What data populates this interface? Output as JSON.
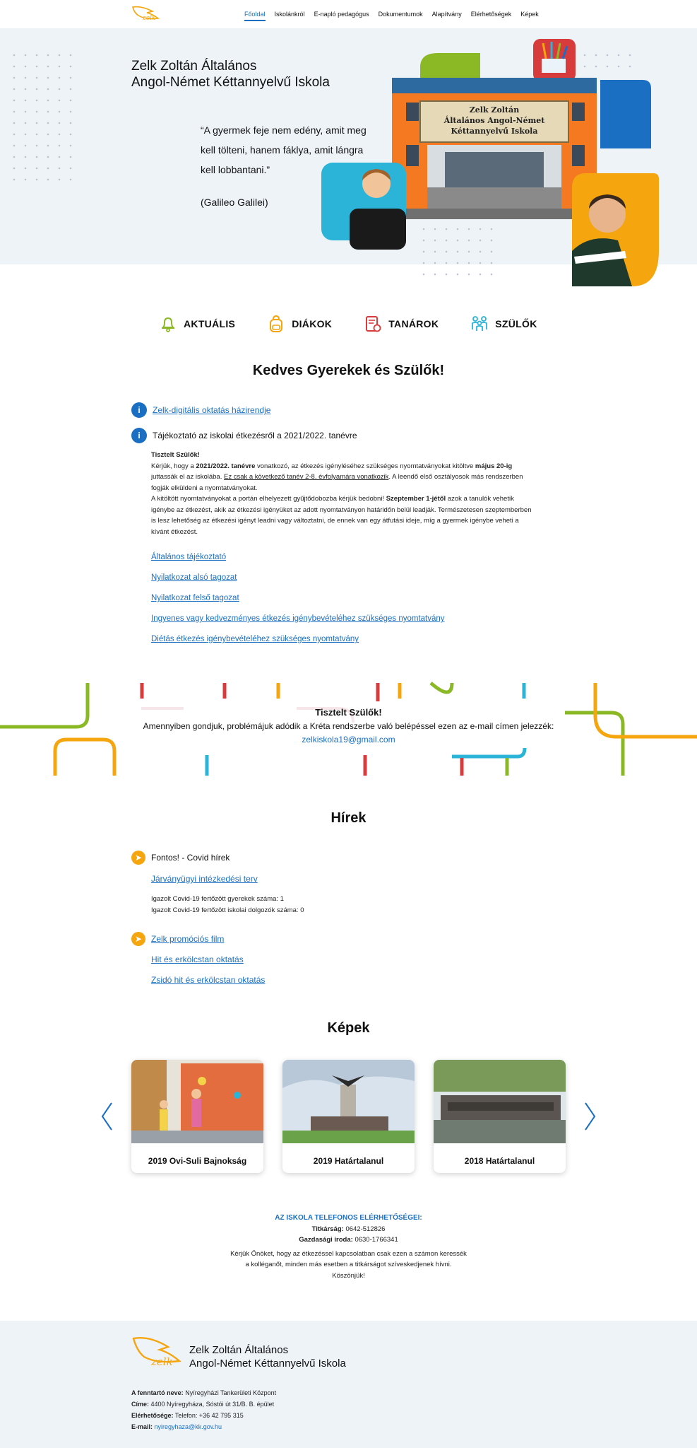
{
  "nav": {
    "items": [
      "Főoldal",
      "Iskolánkról",
      "E-napló pedagógus",
      "Dokumentumok",
      "Alapítvány",
      "Elérhetőségek",
      "Képek"
    ],
    "active": "Főoldal"
  },
  "hero": {
    "title_line1": "Zelk Zoltán Általános",
    "title_line2": "Angol-Német Kéttannyelvű Iskola",
    "quote": "“A gyermek feje nem edény, amit meg kell tölteni, hanem fáklya, amit lángra kell lobbantani.”",
    "author": "(Galileo Galilei)",
    "sign_line1": "Zelk Zoltán",
    "sign_line2": "Általános Angol-Német",
    "sign_line3": "Kéttannyelvű Iskola"
  },
  "categories": [
    {
      "label": "AKTUÁLIS",
      "icon": "bell-icon",
      "color": "#8ab925"
    },
    {
      "label": "DIÁKOK",
      "icon": "backpack-icon",
      "color": "#f5a50e"
    },
    {
      "label": "TANÁROK",
      "icon": "teacher-icon",
      "color": "#d83b3b"
    },
    {
      "label": "SZÜLŐK",
      "icon": "parents-icon",
      "color": "#2bb3d8"
    }
  ],
  "welcome": {
    "heading": "Kedves Gyerekek és Szülők!",
    "link1": "Zelk-digitális oktatás házirendje",
    "item2": "Tájékoztató az iskolai étkezésről a 2021/2022. tanévre",
    "greeting": "Tisztelt Szülők!",
    "p1_a": "Kérjük, hogy a ",
    "p1_b": "2021/2022. tanévre",
    "p1_c": " vonatkozó, az étkezés igényléséhez szükséges nyomtatványokat kitöltve ",
    "p1_d": "május 20-ig",
    "p1_e": " juttassák el az iskolába. ",
    "p1_f": "Ez csak a következő tanév 2-8. évfolyamára vonatkozik",
    "p1_g": ". A leendő első osztályosok más rendszerben fogják elküldeni a nyomtatványokat.",
    "p2_a": "A kitöltött nyomtatványokat a portán elhelyezett gyűjtődobozba kérjük bedobni! ",
    "p2_b": "Szeptember 1-jétől",
    "p2_c": " azok a tanulók vehetik igénybe az étkezést, akik az étkezési igényüket az adott nyomtatványon határidőn belül leadják. Természetesen szeptemberben is lesz lehetőség az étkezési igényt leadni vagy változtatni, de ennek van egy átfutási ideje, míg a gyermek igénybe veheti a kívánt étkezést.",
    "links": [
      "Általános tájékoztató",
      "Nyilatkozat alsó tagozat",
      "Nyilatkozat felső tagozat",
      "Ingyenes vagy kedvezményes étkezés igénybevételéhez szükséges nyomtatvány",
      "Diétás étkezés igénybevételéhez szükséges nyomtatvány"
    ]
  },
  "banner": {
    "title": "Tisztelt Szülők!",
    "text": "Amennyiben gondjuk, problémájuk adódik a Kréta rendszerbe való belépéssel ezen az e-mail címen jelezzék:",
    "email": "zelkiskola19@gmail.com"
  },
  "news": {
    "heading": "Hírek",
    "item1": "Fontos! - Covid hírek",
    "link1": "Járványügyi intézkedési terv",
    "stat1": "Igazolt Covid-19 fertőzött gyerekek száma: 1",
    "stat2": "Igazolt Covid-19 fertőzött iskolai dolgozók száma: 0",
    "link2": "Zelk promóciós film",
    "link3": "Hit és erkölcstan oktatás",
    "link4": "Zsidó hit és erkölcstan oktatás"
  },
  "gallery": {
    "heading": "Képek",
    "cards": [
      "2019 Ovi-Suli Bajnokság",
      "2019 Határtalanul",
      "2018 Határtalanul"
    ]
  },
  "contact": {
    "title": "AZ ISKOLA TELEFONOS ELÉRHETŐSÉGEI:",
    "sec_label": "Titkárság:",
    "sec_value": "0642-512826",
    "eco_label": "Gazdasági iroda:",
    "eco_value": "0630-1766341",
    "note1": "Kérjük Önöket, hogy az étkezéssel kapcsolatban csak ezen a számon keressék",
    "note2": "a kolléganőt, minden más esetben a titkárságot szíveskedjenek hívni.",
    "note3": "Köszönjük!"
  },
  "footer": {
    "title_line1": "Zelk Zoltán Általános",
    "title_line2": "Angol-Német Kéttannyelvű Iskola",
    "owner_label": "A fenntartó neve:",
    "owner": "Nyíregyházi Tankerületi Központ",
    "address_label": "Címe:",
    "address": "4400 Nyíregyháza, Sóstói út 31/B. B. épület",
    "reach_label": "Elérhetősége:",
    "reach": "Telefon: +36 42 795 315",
    "email_label": "E-mail:",
    "email": "nyiregyhaza@kk.gov.hu"
  },
  "colors": {
    "accent": "#1a6fc2",
    "green": "#8ab925",
    "orange": "#f5a50e",
    "red": "#d83b3b",
    "cyan": "#2bb3d8",
    "hero_bg": "#eef3f8"
  }
}
